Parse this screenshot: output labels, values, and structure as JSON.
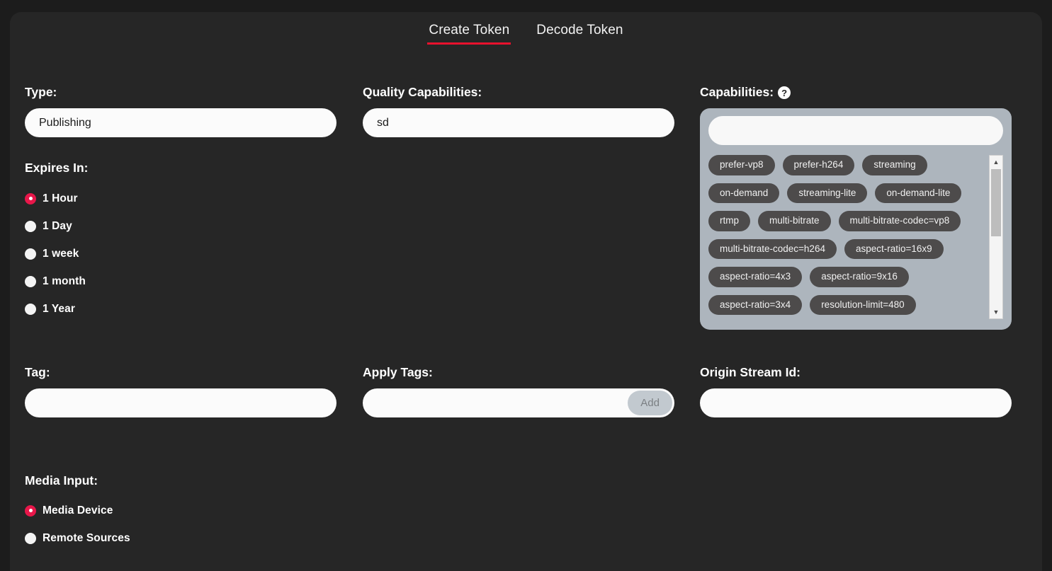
{
  "tabs": [
    {
      "label": "Create Token",
      "active": true
    },
    {
      "label": "Decode Token",
      "active": false
    }
  ],
  "type_field": {
    "label": "Type:",
    "value": "Publishing",
    "placeholder": ""
  },
  "quality_capabilities": {
    "label": "Quality Capabilities:",
    "value": "sd",
    "placeholder": ""
  },
  "capabilities": {
    "label": "Capabilities:",
    "help_icon": "question-mark-icon",
    "search_value": "",
    "search_placeholder": "",
    "tags": [
      "prefer-vp8",
      "prefer-h264",
      "streaming",
      "on-demand",
      "streaming-lite",
      "on-demand-lite",
      "rtmp",
      "multi-bitrate",
      "multi-bitrate-codec=vp8",
      "multi-bitrate-codec=h264",
      "aspect-ratio=16x9",
      "aspect-ratio=4x3",
      "aspect-ratio=9x16",
      "aspect-ratio=3x4",
      "resolution-limit=480"
    ],
    "scrollbar": {
      "up_arrow": "▲",
      "down_arrow": "▼"
    }
  },
  "expires_in": {
    "label": "Expires In:",
    "options": [
      {
        "label": "1 Hour",
        "selected": true
      },
      {
        "label": "1 Day",
        "selected": false
      },
      {
        "label": "1 week",
        "selected": false
      },
      {
        "label": "1 month",
        "selected": false
      },
      {
        "label": "1 Year",
        "selected": false
      }
    ]
  },
  "tag_field": {
    "label": "Tag:",
    "value": "",
    "placeholder": ""
  },
  "apply_tags": {
    "label": "Apply Tags:",
    "value": "",
    "placeholder": "",
    "add_label": "Add"
  },
  "origin_stream_id": {
    "label": "Origin Stream Id:",
    "value": "",
    "placeholder": ""
  },
  "media_input": {
    "label": "Media Input:",
    "options": [
      {
        "label": "Media Device",
        "selected": true
      },
      {
        "label": "Remote Sources",
        "selected": false
      }
    ]
  },
  "colors": {
    "page_background": "#1c1c1c",
    "panel_background": "#262626",
    "accent_red": "#e8112d",
    "radio_selected": "#e8174a",
    "caps_panel": "#adb5bd",
    "tag_chip": "#4d4b4b"
  }
}
